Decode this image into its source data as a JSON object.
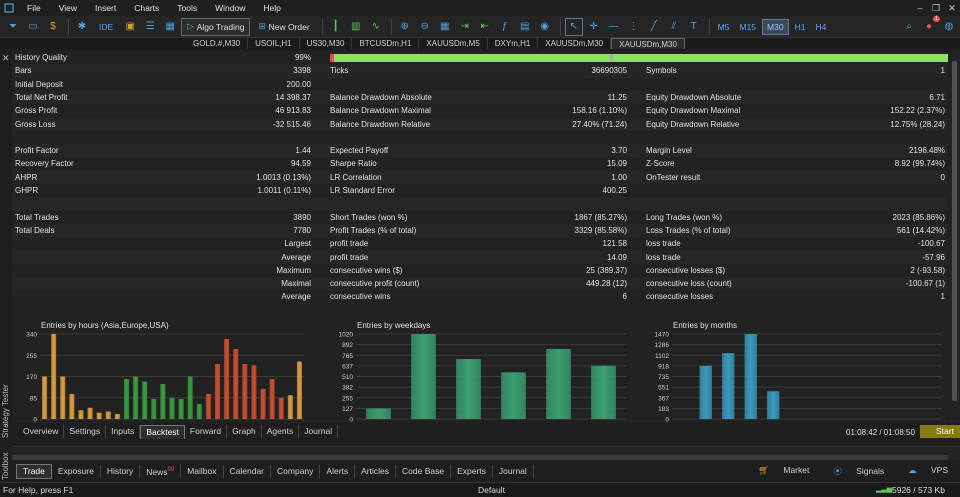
{
  "menu": {
    "items": [
      "File",
      "View",
      "Insert",
      "Charts",
      "Tools",
      "Window",
      "Help"
    ]
  },
  "toolbar": {
    "ide_label": "IDE",
    "algo_trading_label": "Algo Trading",
    "new_order_label": "New Order",
    "timeframes": [
      "M5",
      "M15",
      "M30",
      "H1",
      "H4"
    ],
    "active_timeframe": "M30",
    "notification_count": "1"
  },
  "chart_tabs": [
    "GOLD.#,M30",
    "USOIL,H1",
    "US30,M30",
    "BTCUSDm,H1",
    "XAUUSDm,M5",
    "DXYm,H1",
    "XAUUSDm,M30",
    "XAUUSDm,M30"
  ],
  "report": {
    "history_quality": {
      "label": "History Quality",
      "value": "99%"
    },
    "bars": {
      "label": "Bars",
      "value": "3398"
    },
    "ticks": {
      "label": "Ticks",
      "value": "36690305"
    },
    "symbols": {
      "label": "Symbols",
      "value": "1"
    },
    "initial_deposit": {
      "label": "Initial Deposit",
      "value": "200.00"
    },
    "total_net_profit": {
      "label": "Total Net Profit",
      "value": "14 398.37"
    },
    "balance_dd_abs": {
      "label": "Balance Drawdown Absolute",
      "value": "11.25"
    },
    "equity_dd_abs": {
      "label": "Equity Drawdown Absolute",
      "value": "6.71"
    },
    "gross_profit": {
      "label": "Gross Profit",
      "value": "46 913.83"
    },
    "balance_dd_max": {
      "label": "Balance Drawdown Maximal",
      "value": "158.16 (1.10%)"
    },
    "equity_dd_max": {
      "label": "Equity Drawdown Maximal",
      "value": "152.22 (2.37%)"
    },
    "gross_loss": {
      "label": "Gross Loss",
      "value": "-32 515.46"
    },
    "balance_dd_rel": {
      "label": "Balance Drawdown Relative",
      "value": "27.40% (71.24)"
    },
    "equity_dd_rel": {
      "label": "Equity Drawdown Relative",
      "value": "12.75% (28.24)"
    },
    "profit_factor": {
      "label": "Profit Factor",
      "value": "1.44"
    },
    "expected_payoff": {
      "label": "Expected Payoff",
      "value": "3.70"
    },
    "margin_level": {
      "label": "Margin Level",
      "value": "2196.48%"
    },
    "recovery_factor": {
      "label": "Recovery Factor",
      "value": "94.59"
    },
    "sharpe_ratio": {
      "label": "Sharpe Ratio",
      "value": "15.09"
    },
    "z_score": {
      "label": "Z-Score",
      "value": "8.92 (99.74%)"
    },
    "ahpr": {
      "label": "AHPR",
      "value": "1.0013 (0.13%)"
    },
    "lr_correlation": {
      "label": "LR Correlation",
      "value": "1.00"
    },
    "ontester": {
      "label": "OnTester result",
      "value": "0"
    },
    "ghpr": {
      "label": "GHPR",
      "value": "1.0011 (0.11%)"
    },
    "lr_std_error": {
      "label": "LR Standard Error",
      "value": "400.25"
    },
    "total_trades": {
      "label": "Total Trades",
      "value": "3890"
    },
    "short_trades": {
      "label": "Short Trades (won %)",
      "value": "1867 (85.27%)"
    },
    "long_trades": {
      "label": "Long Trades (won %)",
      "value": "2023 (85.86%)"
    },
    "total_deals": {
      "label": "Total Deals",
      "value": "7780"
    },
    "profit_trades": {
      "label": "Profit Trades (% of total)",
      "value": "3329 (85.58%)"
    },
    "loss_trades": {
      "label": "Loss Trades (% of total)",
      "value": "561 (14.42%)"
    },
    "largest": {
      "label": "Largest",
      "profit_label": "profit trade",
      "profit_value": "121.58",
      "loss_label": "loss trade",
      "loss_value": "-100.67"
    },
    "average": {
      "label": "Average",
      "profit_label": "profit trade",
      "profit_value": "14.09",
      "loss_label": "loss trade",
      "loss_value": "-57.96"
    },
    "maximum": {
      "label": "Maximum",
      "profit_label": "consecutive wins ($)",
      "profit_value": "25 (389.37)",
      "loss_label": "consecutive losses ($)",
      "loss_value": "2 (-93.58)"
    },
    "maximal": {
      "label": "Maximal",
      "profit_label": "consecutive profit (count)",
      "profit_value": "449.28 (12)",
      "loss_label": "consecutive loss (count)",
      "loss_value": "-100.67 (1)"
    },
    "average2": {
      "label": "Average",
      "profit_label": "consecutive wins",
      "profit_value": "6",
      "loss_label": "consecutive losses",
      "loss_value": "1"
    }
  },
  "chart_data": [
    {
      "type": "bar",
      "title": "Entries by hours (Asia,Europe,USA)",
      "yticks": [
        "340",
        "255",
        "170",
        "85",
        "0"
      ],
      "ylim": [
        0,
        340
      ],
      "colors": {
        "asia": "#e0a040",
        "europe": "#3aa040",
        "usa": "#d05030"
      },
      "sessions": [
        "asia",
        "asia",
        "asia",
        "asia",
        "asia",
        "asia",
        "asia",
        "asia",
        "asia",
        "europe",
        "europe",
        "europe",
        "europe",
        "europe",
        "europe",
        "europe",
        "europe",
        "europe",
        "usa",
        "usa",
        "usa",
        "usa",
        "usa",
        "usa",
        "usa",
        "usa",
        "usa",
        "asia",
        "asia"
      ],
      "values": [
        170,
        340,
        170,
        100,
        35,
        45,
        25,
        30,
        20,
        160,
        170,
        150,
        80,
        140,
        85,
        80,
        170,
        60,
        100,
        220,
        320,
        280,
        220,
        215,
        120,
        160,
        85,
        95,
        230
      ]
    },
    {
      "type": "bar",
      "title": "Entries by weekdays",
      "yticks": [
        "1020",
        "892",
        "765",
        "637",
        "510",
        "382",
        "255",
        "127",
        "0"
      ],
      "ylim": [
        0,
        1020
      ],
      "colors": {
        "bar": "#3aa070"
      },
      "values": [
        127,
        1020,
        720,
        560,
        840,
        640
      ]
    },
    {
      "type": "bar",
      "title": "Entries by months",
      "yticks": [
        "1470",
        "1286",
        "1102",
        "918",
        "735",
        "551",
        "367",
        "183",
        "0"
      ],
      "ylim": [
        0,
        1470
      ],
      "colors": {
        "bar": "#3a9ac0"
      },
      "values": [
        0,
        920,
        1140,
        1470,
        480,
        0,
        0,
        0,
        0,
        0,
        0,
        0
      ]
    }
  ],
  "side": {
    "strategy_tester": "Strategy Tester",
    "toolbox": "Toolbox"
  },
  "tester_tabs": [
    "Overview",
    "Settings",
    "Inputs",
    "Backtest",
    "Forward",
    "Graph",
    "Agents",
    "Journal"
  ],
  "tester_active_tab": "Backtest",
  "timer": "01:08:42 / 01:08:50",
  "start_label": "Start",
  "bottom_tabs": [
    "Trade",
    "Exposure",
    "History",
    "News",
    "Mailbox",
    "Calendar",
    "Company",
    "Alerts",
    "Articles",
    "Code Base",
    "Experts",
    "Journal"
  ],
  "news_badge": "99",
  "bottom_right": [
    "Market",
    "Signals",
    "VPS"
  ],
  "status": {
    "help": "For Help, press F1",
    "profile": "Default",
    "traffic": "5926 / 573 Kb"
  }
}
